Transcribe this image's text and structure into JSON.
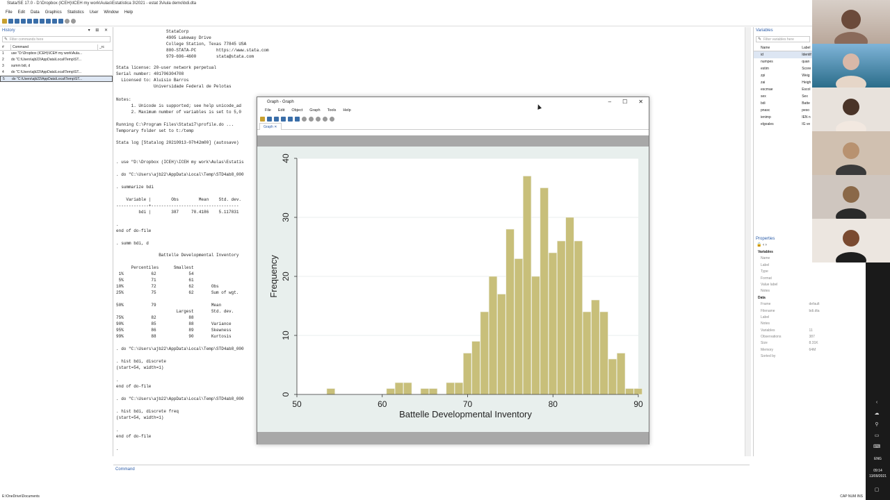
{
  "app": {
    "title": "Stata/SE 17.0 - D:\\Dropbox (ICEH)\\ICEH my work\\Aulas\\Estatística 3\\2021 - estat 3\\Aula demo\\bdi.dta",
    "menu": [
      "File",
      "Edit",
      "Data",
      "Graphics",
      "Statistics",
      "User",
      "Window",
      "Help"
    ]
  },
  "history": {
    "title": "History",
    "filter_placeholder": "Filter commands here",
    "col_num": "#",
    "col_command": "Command",
    "col_rc": "_rc",
    "rows": [
      {
        "n": "1",
        "cmd": "use \"D:\\Dropbox (ICEH)\\ICEH my work\\Aula..."
      },
      {
        "n": "2",
        "cmd": "do \"C:\\Users\\ajb22\\AppData\\Local\\Temp\\ST..."
      },
      {
        "n": "3",
        "cmd": "summ bdi, d"
      },
      {
        "n": "4",
        "cmd": "do \"C:\\Users\\ajb22\\AppData\\Local\\Temp\\ST..."
      },
      {
        "n": "5",
        "cmd": "do \"C:\\Users\\ajb22\\AppData\\Local\\Temp\\ST..."
      }
    ]
  },
  "results": {
    "header_block": "                    StataCorp\n                    4905 Lakeway Drive\n                    College Station, Texas 77845 USA\n                    800-STATA-PC        https://www.stata.com\n                    979-696-4600        stata@stata.com",
    "license_block": "Stata license: 20-user network perpetual\nSerial number: 401706304708\n  Licensed to: Aluísio Barros\n               Universidade Federal de Pelotas",
    "notes_block": "Notes:\n      1. Unicode is supported; see help unicode_ad\n      2. Maximum number of variables is set to 5,0",
    "run_block": "Running C:\\Program Files\\Stata17\\profile.do ...\nTemporary folder set to t:/temp",
    "log_line": "Stata log [Statalog 20210913-07h42m00] (autosave)",
    "cmds_block": ". use \"D:\\Dropbox (ICEH)\\ICEH my work\\Aulas\\Estatís\n\n. do \"C:\\Users\\ajb22\\AppData\\Local\\Temp\\STD4ab8_000\n\n. summarize bdi",
    "summ_table": "    Variable |        Obs        Mean    Std. dev.\n-------------+-----------------------------------\n         bdi |        387     78.4186    5.117831",
    "end1": ".\nend of do-file\n\n. summ bdi, d",
    "detail_title": "                 Battelle Developmental Inventory",
    "detail_table": "      Percentiles      Smallest\n 1%           62             54\n 5%           71             61\n10%           72             62       Obs\n25%           75             62       Sum of wgt.\n\n50%           79                      Mean\n                        Largest       Std. dev.\n75%           82             88\n90%           85             88       Variance\n95%           86             89       Skewness\n99%           88             90       Kurtosis",
    "tail_block": ". do \"C:\\Users\\ajb22\\AppData\\Local\\Temp\\STD4ab8_000\n\n. hist bdi, discrete\n(start=54, width=1)\n\n.\nend of do-file\n\n. do \"C:\\Users\\ajb22\\AppData\\Local\\Temp\\STD4ab8_000\n\n. hist bdi, discrete freq\n(start=54, width=1)\n\n.\nend of do-file\n\n."
  },
  "command_label": "Command",
  "status_path": "E:\\OneDrive\\Documents",
  "status_right": "CAP  NUM  INS",
  "variables": {
    "title": "Variables",
    "filter_placeholder": "Filter variables here",
    "col_name": "Name",
    "col_label": "Label",
    "rows": [
      {
        "name": "id",
        "label": "Identif"
      },
      {
        "name": "numpes",
        "label": "quan"
      },
      {
        "name": "estim",
        "label": "Score"
      },
      {
        "name": "zpi",
        "label": "Weig"
      },
      {
        "name": "zai",
        "label": "Heigh"
      },
      {
        "name": "escmae",
        "label": "Escol"
      },
      {
        "name": "sex",
        "label": "Sex"
      },
      {
        "name": "bdi",
        "label": "Batte"
      },
      {
        "name": "pnasc",
        "label": "peso"
      },
      {
        "name": "ienimp",
        "label": "IEN n"
      },
      {
        "name": "elgoales",
        "label": "IG ve"
      }
    ]
  },
  "properties": {
    "title": "Properties",
    "rows": [
      {
        "k": "Variables",
        "v": "",
        "grp": true
      },
      {
        "k": "Name",
        "v": ""
      },
      {
        "k": "Label",
        "v": ""
      },
      {
        "k": "Type",
        "v": ""
      },
      {
        "k": "Format",
        "v": ""
      },
      {
        "k": "Value label",
        "v": ""
      },
      {
        "k": "Notes",
        "v": ""
      },
      {
        "k": "Data",
        "v": "",
        "grp": true
      },
      {
        "k": "Frame",
        "v": "default"
      },
      {
        "k": "Filename",
        "v": "bdi.dta"
      },
      {
        "k": "Label",
        "v": ""
      },
      {
        "k": "Notes",
        "v": ""
      },
      {
        "k": "Variables",
        "v": "11"
      },
      {
        "k": "Observations",
        "v": "387"
      },
      {
        "k": "Size",
        "v": "8.31K"
      },
      {
        "k": "Memory",
        "v": "64M"
      },
      {
        "k": "Sorted by",
        "v": ""
      }
    ]
  },
  "graph_window": {
    "title": "Graph - Graph",
    "menu": [
      "File",
      "Edit",
      "Object",
      "Graph",
      "Tools",
      "Help"
    ],
    "tab": "Graph"
  },
  "chart_data": {
    "type": "bar",
    "xlabel": "Battelle Developmental Inventory",
    "ylabel": "Frequency",
    "xlim": [
      50,
      90
    ],
    "ylim": [
      0,
      40
    ],
    "x_ticks": [
      "50",
      "60",
      "70",
      "80",
      "90"
    ],
    "y_ticks": [
      "0",
      "10",
      "20",
      "30",
      "40"
    ],
    "x": [
      54,
      61,
      62,
      63,
      65,
      66,
      68,
      69,
      70,
      71,
      72,
      73,
      74,
      75,
      76,
      77,
      78,
      79,
      80,
      81,
      82,
      83,
      84,
      85,
      86,
      87,
      88,
      89,
      90
    ],
    "values": [
      1,
      1,
      2,
      2,
      1,
      1,
      2,
      2,
      7,
      9,
      14,
      20,
      17,
      28,
      23,
      37,
      20,
      35,
      24,
      26,
      30,
      26,
      14,
      16,
      14,
      6,
      7,
      1,
      1
    ],
    "bar_color": "#c8bf7a",
    "plot_bg": "#eef3f1",
    "grid": true
  },
  "taskbar": {
    "lang": "ENG",
    "time": "09:14",
    "date": "13/09/2021"
  }
}
